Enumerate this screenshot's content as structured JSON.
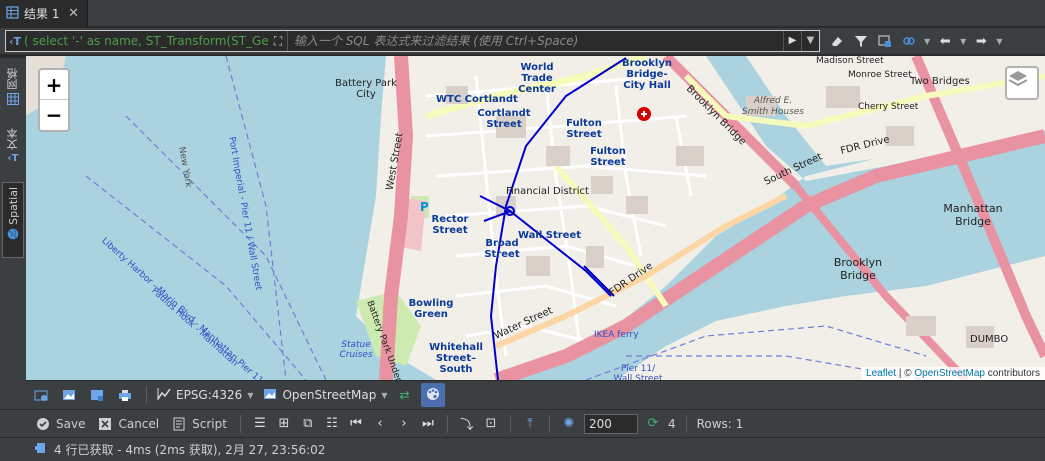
{
  "tab": {
    "title": "结果 1",
    "close": "✕"
  },
  "filter": {
    "prefix": "‹T",
    "expression": "( select '-' as name, ST_Transform(ST_Ge",
    "placeholder": "输入一个 SQL 表达式来过滤结果 (使用 Ctrl+Space)"
  },
  "side_tabs": [
    {
      "label": "网格",
      "icon": "grid-icon"
    },
    {
      "label": "文本",
      "icon": "text-icon"
    },
    {
      "label": "Spatial",
      "icon": "globe-icon"
    }
  ],
  "map": {
    "zoom_in": "+",
    "zoom_out": "−",
    "attribution_leaflet": "Leaflet",
    "attribution_sep": " | © ",
    "attribution_osm": "OpenStreetMap",
    "attribution_tail": " contributors",
    "labels": {
      "world_trade_center": "World\nTrade\nCenter",
      "brooklyn_bridge_city_hall": "Brooklyn\nBridge-\nCity Hall",
      "battery_park_city": "Battery Park\nCity",
      "wtc_cortlandt": "WTC Cortlandt",
      "cortlandt_street": "Cortlandt\nStreet",
      "fulton_street_1": "Fulton\nStreet",
      "fulton_street_2": "Fulton\nStreet",
      "financial_district": "Financial District",
      "rector_street": "Rector\nStreet",
      "wall_street": "Wall Street",
      "broad_street": "Broad\nStreet",
      "bowling_green": "Bowling\nGreen",
      "whitehall": "Whitehall\nStreet–\nSouth",
      "manhattan_bridge": "Manhattan\nBridge",
      "brooklyn_bridge": "Brooklyn\nBridge",
      "two_bridges": "Two Bridges",
      "alfred_smith": "Alfred E.\nSmith Houses",
      "west_street": "West Street",
      "fdr_drive": "FDR Drive",
      "brooklyn_bridge_road": "Brooklyn Bridge",
      "water_street": "Water Street",
      "south_street": "South Street",
      "dumbo": "DUMBO",
      "ikea_ferry": "IKEA ferry",
      "pier11": "Pier 11/\nWall Street",
      "statue_cruises": "Statue\nCruises",
      "battery_park_underpass": "Battery Park Underpass",
      "madison_street": "Madison Street",
      "monroe_street": "Monroe Street",
      "cherry_street": "Cherry Street",
      "liberty_harbor": "Liberty Harbor - Marin Blvd - Manhattan Pier 11 / Wall St",
      "paulus_hook": "Paulus Hook - Manhattan",
      "port_imperial": "Port Imperial - Pier 11 / Wall Street",
      "new_york": "New York"
    }
  },
  "toolbar1": {
    "crs": "EPSG:4326",
    "tiles": "OpenStreetMap"
  },
  "toolbar2": {
    "save": "Save",
    "cancel": "Cancel",
    "script": "Script",
    "fetch_size": "200",
    "refresh_count": "4",
    "rows": "Rows: 1"
  },
  "status": {
    "text": "4 行已获取 - 4ms (2ms 获取), 2月 27, 23:56:02"
  },
  "colors": {
    "accent": "#4b6eaf",
    "map_water": "#aad3df",
    "map_land": "#f2efe9",
    "road_primary": "#f6fabb",
    "road_motorway": "#e892a2",
    "route_line": "#0000cc",
    "filter_expression": "#4d9b4d"
  }
}
